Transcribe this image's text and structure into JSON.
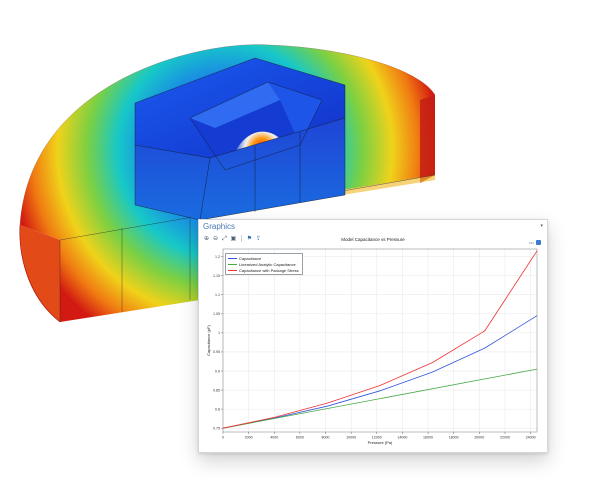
{
  "window": {
    "title": "Graphics",
    "pin_glyph": "▾"
  },
  "toolbar": {
    "icons": [
      "zoom-in-icon",
      "zoom-out-icon",
      "zoom-extents-icon",
      "zoom-box-icon",
      "camera-icon",
      "export-icon"
    ],
    "glyphs": [
      "⊕",
      "⊖",
      "⤢",
      "▣",
      "⚑",
      "⇪"
    ]
  },
  "plot_tools": {
    "label": "Plot",
    "glyph": "⛶"
  },
  "colors": {
    "series_capacitance": "#3355dd",
    "series_linearized": "#44aa44",
    "series_package_stress": "#ee3333",
    "title_accent": "#4a78b5"
  },
  "chart_data": {
    "type": "line",
    "title": "Model Capacitance vs Pressure",
    "xlabel": "Pressure (Pa)",
    "ylabel": "Capacitance (pF)",
    "xlim": [
      0,
      15000
    ],
    "ylim": [
      0.74,
      1.22
    ],
    "xticks": [
      0,
      2000,
      4000,
      6000,
      8000,
      10000,
      12000,
      14000,
      16000,
      18000,
      20000,
      22000,
      24000
    ],
    "xtick_labels": [
      "0",
      "2000",
      "4000",
      "6000",
      "8000",
      "10000",
      "12000",
      "14000",
      "16000",
      "18000",
      "20000",
      "22000",
      "24000"
    ],
    "yticks": [
      0.75,
      0.8,
      0.85,
      0.9,
      0.95,
      1.0,
      1.05,
      1.1,
      1.15,
      1.2
    ],
    "ytick_labels": [
      "0.75",
      "0.8",
      "0.85",
      "0.9",
      "0.95",
      "1",
      "1.05",
      "1.1",
      "1.15",
      "1.2"
    ],
    "grid": true,
    "legend_position": "top-left",
    "series": [
      {
        "name": "Capacitance",
        "color": "#3355dd",
        "x": [
          0,
          2500,
          5000,
          7500,
          10000,
          12500,
          15000
        ],
        "y": [
          0.75,
          0.777,
          0.808,
          0.848,
          0.897,
          0.96,
          1.045
        ]
      },
      {
        "name": "Linearized Analytic Capacitance",
        "color": "#44aa44",
        "x": [
          0,
          15000
        ],
        "y": [
          0.75,
          0.905
        ]
      },
      {
        "name": "Capacitance with Package Stress",
        "color": "#ee3333",
        "x": [
          0,
          2500,
          5000,
          7500,
          10000,
          12500,
          15000
        ],
        "y": [
          0.75,
          0.779,
          0.816,
          0.862,
          0.922,
          1.005,
          1.215
        ]
      }
    ]
  }
}
